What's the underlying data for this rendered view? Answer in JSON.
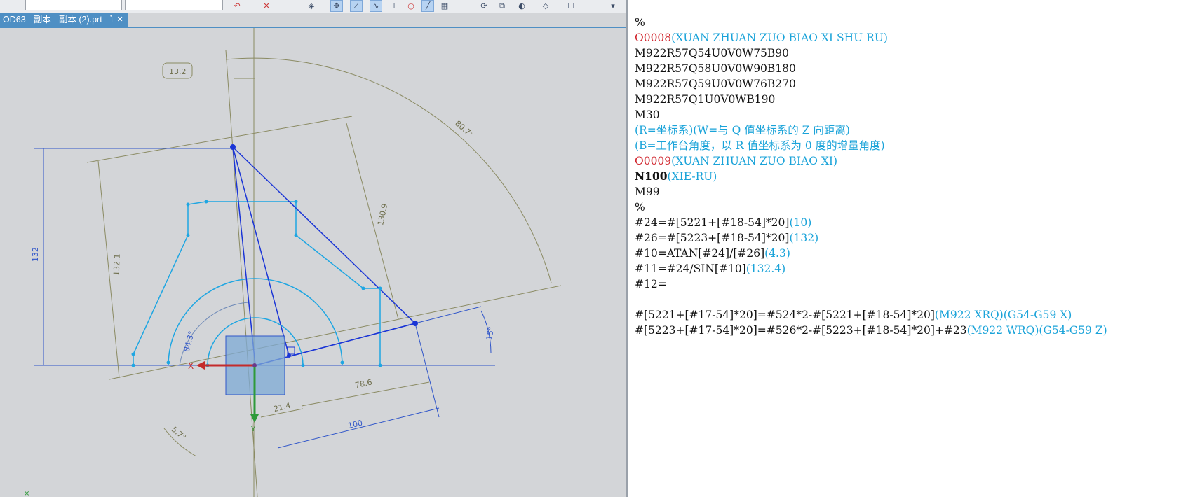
{
  "tab": {
    "title": "OD63 - 副本 - 副本 (2).prt"
  },
  "toolbar": {
    "icons": [
      "eraser-icon",
      "snap-point-icon",
      "line-icon",
      "spline-icon",
      "intersection-icon",
      "circle-icon",
      "line-icon",
      "grid-icon",
      "rotate-icon",
      "view-icon",
      "render-icon",
      "layer-icon",
      "box-icon"
    ]
  },
  "drawing": {
    "dimensions": {
      "d13_2": "13.2",
      "d80_7": "80.7°",
      "d130_9": "130.9",
      "d132_1": "132.1",
      "d132": "132",
      "d84_3": "84.3°",
      "d15": "15°",
      "d78_6": "78.6",
      "d21_4": "21.4",
      "d100": "100",
      "d5_7": "5.7°"
    },
    "axis": {
      "x": "X",
      "y": "Y"
    }
  },
  "editor": {
    "lines": [
      [
        {
          "t": "%",
          "c": "n"
        }
      ],
      [
        {
          "t": "O0008",
          "c": "r"
        },
        {
          "t": "(XUAN ZHUAN ZUO BIAO XI SHU RU)",
          "c": "c"
        }
      ],
      [
        {
          "t": "M922R57Q54U0V0W75B90",
          "c": "n"
        }
      ],
      [
        {
          "t": "M922R57Q58U0V0W90B180",
          "c": "n"
        }
      ],
      [
        {
          "t": "M922R57Q59U0V0W76B270",
          "c": "n"
        }
      ],
      [
        {
          "t": "M922R57Q1U0V0WB190",
          "c": "n"
        }
      ],
      [
        {
          "t": "M30",
          "c": "n"
        }
      ],
      [
        {
          "t": "(R=坐标系)(W=与 Q 值坐标系的 Z 向距离)",
          "c": "c"
        }
      ],
      [
        {
          "t": "(B=工作台角度，以 R 值坐标系为 0 度的增量角度)",
          "c": "c"
        }
      ],
      [
        {
          "t": "O0009",
          "c": "r"
        },
        {
          "t": "(XUAN ZHUAN ZUO BIAO XI)",
          "c": "c"
        }
      ],
      [
        {
          "t": "N100",
          "c": "b"
        },
        {
          "t": "(XIE-RU)",
          "c": "c"
        }
      ],
      [
        {
          "t": "M99",
          "c": "n"
        }
      ],
      [
        {
          "t": "%",
          "c": "n"
        }
      ],
      [
        {
          "t": "#24=#[5221+[#18-54]*20]",
          "c": "n"
        },
        {
          "t": "(10)",
          "c": "c"
        }
      ],
      [
        {
          "t": "#26=#[5223+[#18-54]*20]",
          "c": "n"
        },
        {
          "t": "(132)",
          "c": "c"
        }
      ],
      [
        {
          "t": "#10=ATAN[#24]/[#26]",
          "c": "n"
        },
        {
          "t": "(4.3)",
          "c": "c"
        }
      ],
      [
        {
          "t": "#11=#24/SIN[#10]",
          "c": "n"
        },
        {
          "t": "(132.4)",
          "c": "c"
        }
      ],
      [
        {
          "t": "#12=",
          "c": "n"
        }
      ],
      [],
      [
        {
          "t": "#[5221+[#17-54]*20]=#524*2-#[5221+[#18-54]*20]",
          "c": "n"
        },
        {
          "t": "(M922 XRQ)(G54-G59 X)",
          "c": "c"
        }
      ],
      [
        {
          "t": "#[5223+[#17-54]*20]=#526*2-#[5223+[#18-54]*20]+#23",
          "c": "n"
        },
        {
          "t": "(M922 WRQ)(G54-G59 Z)",
          "c": "c"
        }
      ]
    ]
  }
}
